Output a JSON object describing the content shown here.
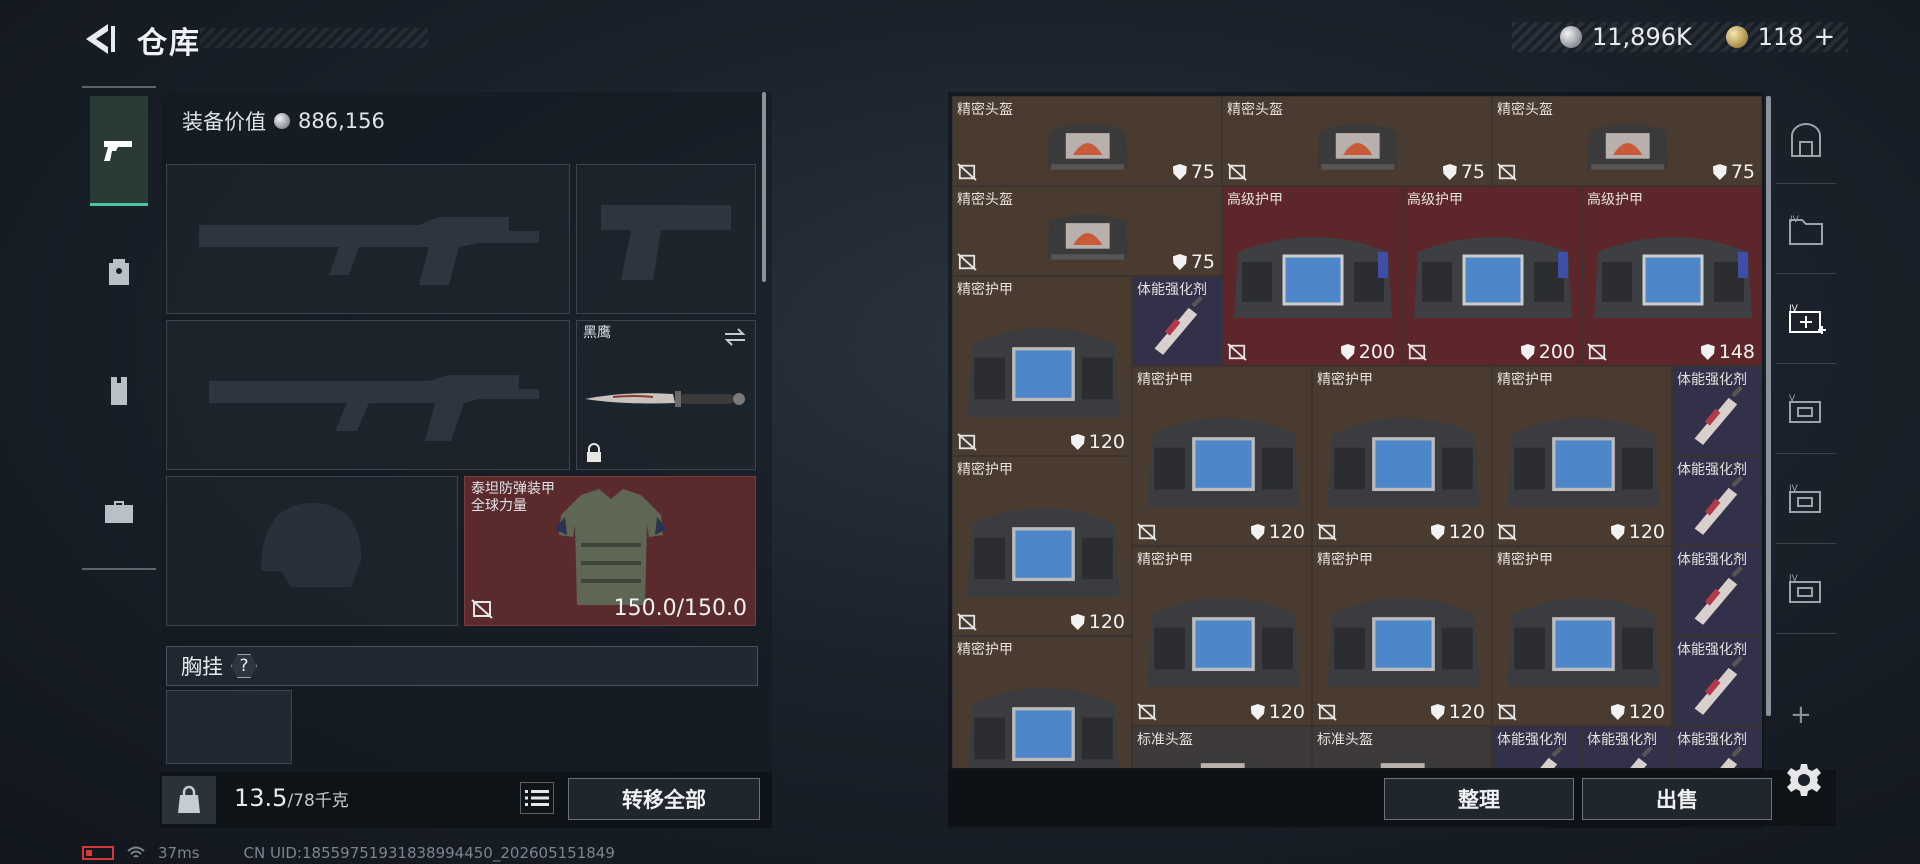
{
  "header": {
    "title": "仓库",
    "currency_silver": "11,896K",
    "currency_gold": "118",
    "plus": "+"
  },
  "equipment": {
    "value_label": "装备价值",
    "value": "886,156",
    "knife_name": "黑鹰",
    "armor_name_line1": "泰坦防弹装甲",
    "armor_name_line2": "全球力量",
    "armor_durability": "150.0/150.0",
    "chest_label": "胸挂",
    "chest_help": "?"
  },
  "footer_left": {
    "weight_current": "13.5",
    "weight_max": "/78千克",
    "transfer_all": "转移全部"
  },
  "footer_right": {
    "sort": "整理",
    "sell": "出售",
    "add": "+"
  },
  "status": {
    "ping": "37ms",
    "uid": "CN UID:18559751931838994450_202605151849"
  },
  "stash_items": [
    {
      "name": "精密头盔",
      "value": "75"
    },
    {
      "name": "精密头盔",
      "value": "75"
    },
    {
      "name": "精密头盔",
      "value": "75"
    },
    {
      "name": "精密头盔",
      "value": "75"
    },
    {
      "name": "高级护甲",
      "value": "200"
    },
    {
      "name": "高级护甲",
      "value": "200"
    },
    {
      "name": "高级护甲",
      "value": "148"
    },
    {
      "name": "精密护甲",
      "value": "120"
    },
    {
      "name": "体能强化剂",
      "value": ""
    },
    {
      "name": "精密护甲",
      "value": "120"
    },
    {
      "name": "精密护甲",
      "value": "120"
    },
    {
      "name": "精密护甲",
      "value": "120"
    },
    {
      "name": "体能强化剂",
      "value": ""
    },
    {
      "name": "精密护甲",
      "value": "120"
    },
    {
      "name": "体能强化剂",
      "value": ""
    },
    {
      "name": "精密护甲",
      "value": "120"
    },
    {
      "name": "精密护甲",
      "value": "120"
    },
    {
      "name": "精密护甲",
      "value": "120"
    },
    {
      "name": "体能强化剂",
      "value": ""
    },
    {
      "name": "精密护甲",
      "value": "120"
    },
    {
      "name": "体能强化剂",
      "value": ""
    },
    {
      "name": "标准头盔",
      "value": ""
    },
    {
      "name": "标准头盔",
      "value": ""
    },
    {
      "name": "体能强化剂",
      "value": ""
    },
    {
      "name": "体能强化剂",
      "value": ""
    },
    {
      "name": "体能强化剂",
      "value": ""
    }
  ],
  "sidebar_tabs": [
    "weapon-tab",
    "backpack-tab",
    "rig-tab",
    "case-tab"
  ],
  "colors": {
    "accent": "#4ec3a2",
    "rarity_brown": "#4a3b30",
    "rarity_red": "#5d262b",
    "rarity_purple": "#33304a"
  }
}
